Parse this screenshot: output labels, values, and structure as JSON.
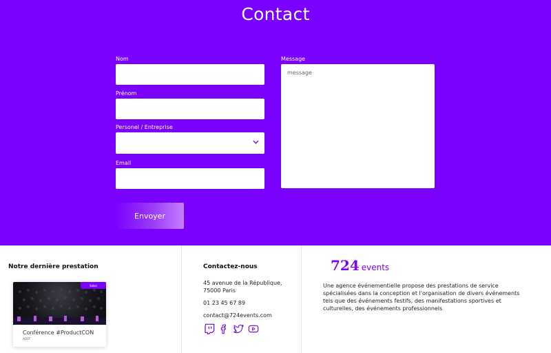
{
  "header": {
    "title": "Contact"
  },
  "form": {
    "nom_label": "Nom",
    "prenom_label": "Prénom",
    "type_label": "Personel / Entreprise",
    "email_label": "Email",
    "message_label": "Message",
    "message_placeholder": "message",
    "submit_label": "Envoyer"
  },
  "footer": {
    "latest": {
      "heading": "Notre dernière prestation",
      "card_title": "Conférence #ProductCON",
      "card_date": "AOÛT",
      "card_badge": "Salon"
    },
    "contact": {
      "heading": "Contactez-nous",
      "address_line1": "45 avenue de la République,",
      "address_line2": "75000 Paris",
      "phone": "01 23 45 67 89",
      "email": "contact@724events.com",
      "social_icons": [
        "twitch-icon",
        "facebook-icon",
        "twitter-icon",
        "youtube-icon"
      ]
    },
    "brand": {
      "number": "724",
      "word": "events",
      "description": "Une agence événementielle propose des prestations de service spécialisées dans la conception et l'organisation de divers événements tels que des événements festifs, des manifestations sportives et culturelles, des événements professionnels"
    }
  },
  "colors": {
    "primary": "#7a00ff",
    "white": "#ffffff"
  }
}
